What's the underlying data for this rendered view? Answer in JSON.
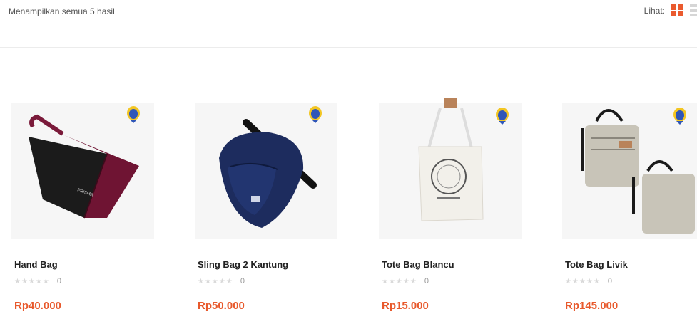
{
  "toolbar": {
    "result_count": "Menampilkan semua 5 hasil",
    "view_label": "Lihat:"
  },
  "accent_color": "#e8592c",
  "products": [
    {
      "name": "Hand Bag",
      "rating_stars": "★★★★★",
      "rating": 0,
      "review_count": "0",
      "price": "Rp40.000",
      "image_icon": "hand-bag"
    },
    {
      "name": "Sling Bag 2 Kantung",
      "rating_stars": "★★★★★",
      "rating": 0,
      "review_count": "0",
      "price": "Rp50.000",
      "image_icon": "sling-bag"
    },
    {
      "name": "Tote Bag Blancu",
      "rating_stars": "★★★★★",
      "rating": 0,
      "review_count": "0",
      "price": "Rp15.000",
      "image_icon": "tote-bag"
    },
    {
      "name": "Tote Bag Livik",
      "rating_stars": "★★★★★",
      "rating": 0,
      "review_count": "0",
      "price": "Rp145.000",
      "image_icon": "tote-bag-pair"
    }
  ]
}
